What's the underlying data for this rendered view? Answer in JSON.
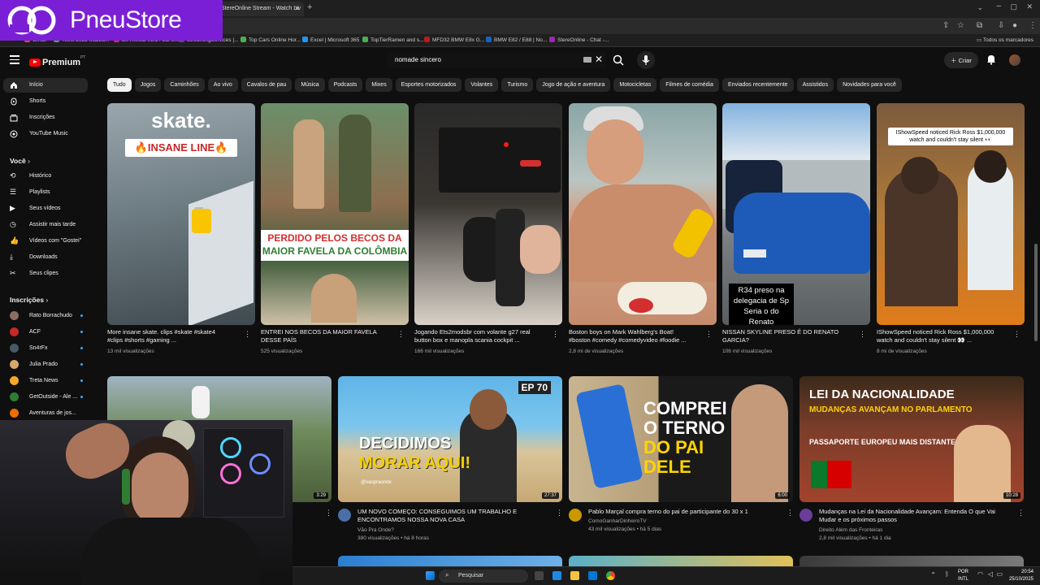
{
  "browser": {
    "tab_title": "StereOnline Stream - Watch Liv",
    "bookmarks": [
      "Gmail",
      "Tetris 2025 Mazza...",
      "Ex-Rivista V2.5 / Lui el...",
      "StreamingServices |...",
      "Top Cars Online Hor...",
      "Excel | Microsoft 365",
      "TopTierRamen and s...",
      "MFD32 BMW E8x G...",
      "BMW E82 / E88 | No...",
      "StereOnline - Chat -..."
    ],
    "bookmarks_all": "Todos os marcadores"
  },
  "overlay_logo": {
    "name": "PneuStore"
  },
  "youtube": {
    "logo_text": "Premium",
    "logo_sup": "PT",
    "search_value": "nomade sincero",
    "create_label": "Criar",
    "chips": [
      "Tudo",
      "Jogos",
      "Caminhões",
      "Ao vivo",
      "Cavalos de pau",
      "Música",
      "Podcasts",
      "Mixes",
      "Esportes motorizados",
      "Volantes",
      "Turismo",
      "Jogo de ação e aventura",
      "Motocicletas",
      "Filmes de comédia",
      "Enviados recentemente",
      "Assistidos",
      "Novidades para você"
    ],
    "sidebar": {
      "main": [
        "Início",
        "Shorts",
        "Inscrições",
        "YouTube Music"
      ],
      "you_header": "Você",
      "you": [
        "Histórico",
        "Playlists",
        "Seus vídeos",
        "Assistir mais tarde",
        "Vídeos com \"Gostei\"",
        "Downloads",
        "Seus clipes"
      ],
      "subs_header": "Inscrições",
      "subs": [
        "Rato Borrachudo",
        "ACF",
        "Sn4rFx",
        "Julia Prado",
        "Treta News",
        "GetOutside - Ale ...",
        "Aventuras de jos..."
      ]
    },
    "shorts": [
      {
        "title1": "More insane skate. clips #skate #skate4",
        "title2": "#clips #shorts #gaming ...",
        "views": "13 mil visualizações",
        "overlay_top": "skate.",
        "overlay_badge": "🔥INSANE LINE🔥"
      },
      {
        "title1": "ENTREI NOS BECOS DA MAIOR FAVELA",
        "title2": "DESSE PAÍS",
        "views": "525 visualizações",
        "overlay_a": "PERDIDO PELOS BECOS DA",
        "overlay_b": "MAIOR FAVELA DA COLÔMBIA"
      },
      {
        "title1": "Jogando Ets2modsbr com volante g27 real",
        "title2": "button box e manopla scania cockpit ...",
        "views": "166 mil visualizações"
      },
      {
        "title1": "Boston boys on Mark Wahlberg's Boat!",
        "title2": "#boston #comedy #comedyvideo #foodie ...",
        "views": "2,8 mi de visualizações"
      },
      {
        "title1": "NISSAN SKYLINE PRESO É DO RENATO",
        "title2": "GARCIA?",
        "views": "106 mil visualizações",
        "overlay": "R34 preso na delegacia de Sp Seria o do Renato"
      },
      {
        "title1": "IShowSpeed noticed Rick Ross $1,000,000",
        "title2": "watch and couldn't stay silent 👀 ...",
        "views": "8 mi de visualizações",
        "overlay": "IShowSpeed noticed Rick Ross $1,000,000 watch and couldn't stay silent 👀"
      }
    ],
    "videos": [
      {
        "title1": "",
        "title2": "",
        "channel": "",
        "meta": "",
        "duration": "3:29"
      },
      {
        "title1": "UM NOVO COMEÇO: CONSEGUIMOS UM TRABALHO E",
        "title2": "ENCONTRAMOS NOSSA NOVA CASA",
        "channel": "Vão Pra Onde?",
        "meta": "380 visualizações • há 8 horas",
        "duration": "27:37",
        "ep": "EP 70",
        "overlay1": "DECIDIMOS",
        "overlay2": "MORAR AQUI!",
        "handle": "@vaopraonde"
      },
      {
        "title1": "Pablo Marçal compra terno do pai de participante do 30 x 1",
        "title2": "",
        "channel": "ComoGanharDinheiroTV",
        "meta": "43 mil visualizações • há 5 dias",
        "duration": "6:00",
        "overlay1": "COMPREI",
        "overlay2": "O TERNO",
        "overlay3": "DO PAI",
        "overlay4": "DELE"
      },
      {
        "title1": "Mudanças na Lei da Nacionalidade Avançam: Entenda O que Vai",
        "title2": "Mudar e os próximos passos",
        "channel": "Direito Além das Fronteiras",
        "meta": "2,8 mil visualizações • há 1 dia",
        "duration": "10:28",
        "overlay1": "LEI DA NACIONALIDADE",
        "overlay2": "MUDANÇAS AVANÇAM NO PARLAMENTO",
        "overlay3": "PASSAPORTE EUROPEU MAIS DISTANTE..."
      }
    ]
  },
  "taskbar": {
    "search_label": "Pesquisar",
    "lang1": "POR",
    "lang2": "INTL",
    "time": "20:54",
    "date": "25/10/2025"
  },
  "colors": {
    "brand": "#7b1fd6",
    "yt_red": "#ff0000",
    "bg": "#0f0f0f"
  }
}
